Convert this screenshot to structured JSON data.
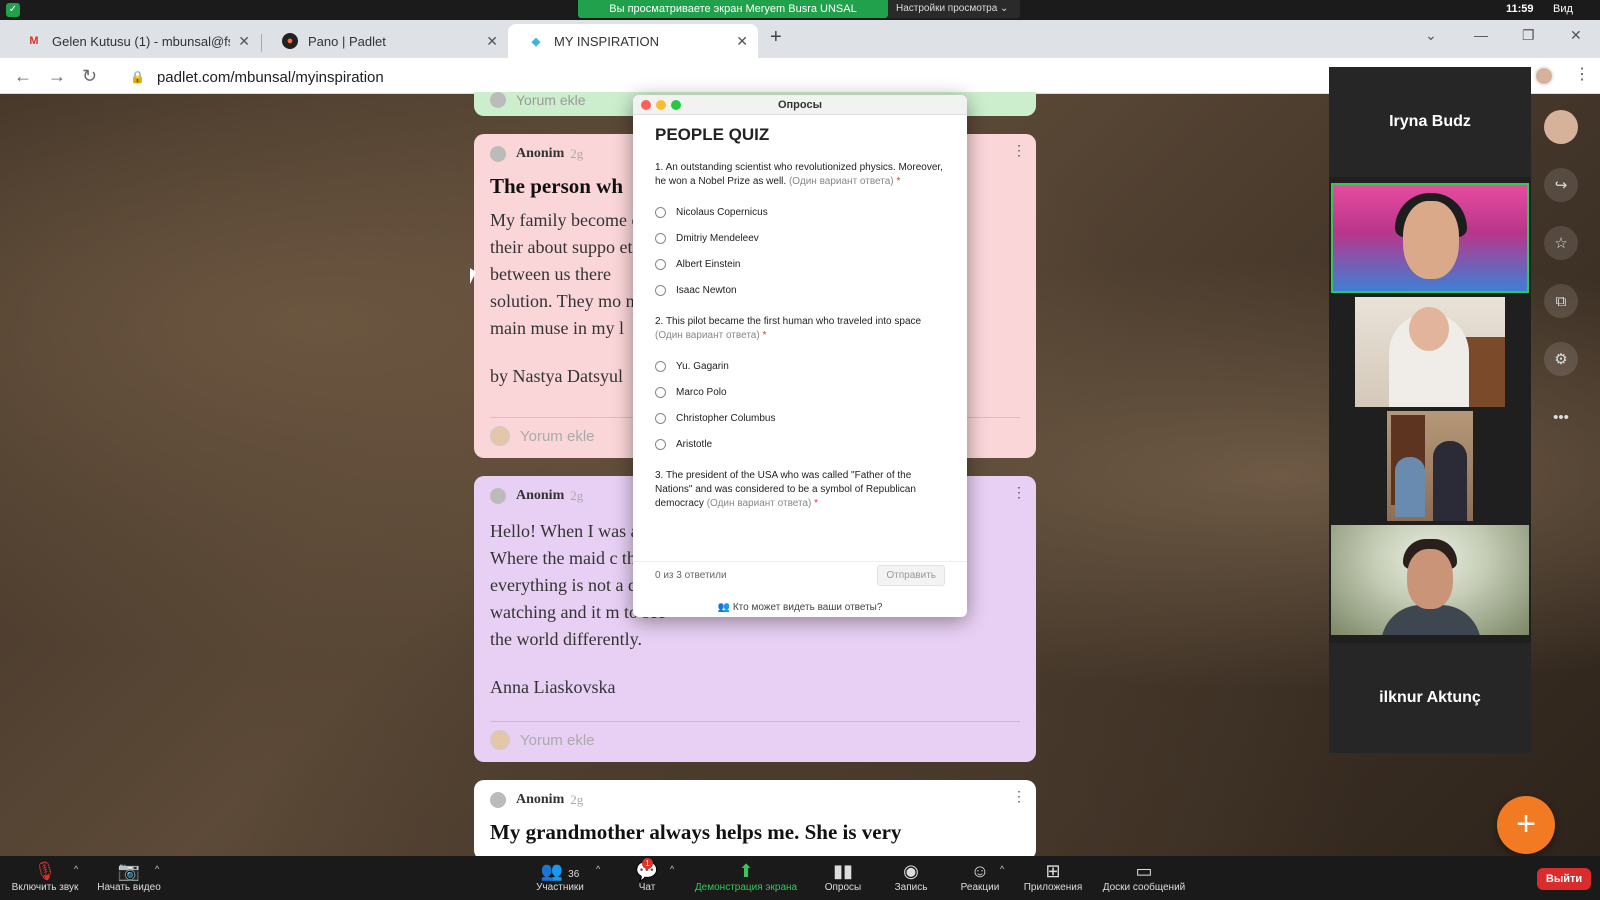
{
  "zoom_top": {
    "share_banner": "Вы просматриваете экран Meryem Busra UNSAL",
    "view_settings": "Настройки просмотра ⌄",
    "clock": "11:59",
    "view_label": "Вид"
  },
  "browser": {
    "tabs": [
      {
        "title": "Gelen Kutusu (1) - mbunsal@fsm",
        "icon": "gmail-icon"
      },
      {
        "title": "Pano | Padlet",
        "icon": "padlet-icon"
      },
      {
        "title": "MY INSPIRATION",
        "icon": "padlet-diamond-icon"
      }
    ],
    "url": "padlet.com/mbunsal/myinspiration"
  },
  "posts": {
    "top_comment": "Yorum ekle",
    "pink": {
      "author": "Anonim",
      "time": "2g",
      "title": "The person wh",
      "lines": [
        "My family become                                                    can ask",
        "their about suppo                                                   etimes",
        "between us there",
        "solution. They mo                                                   ny",
        "main muse in my l"
      ],
      "signature": "by Nastya Datsyul",
      "comment": "Yorum ekle"
    },
    "purple": {
      "author": "Anonim",
      "time": "2g",
      "lines": [
        "Hello! When I was                                                 atrix.",
        "Where the maid c                                                  that",
        "everything is not a                                               d while",
        "watching and it m                                                 to see",
        "the world differently."
      ],
      "signature": "Anna Liaskovska",
      "comment": "Yorum ekle"
    },
    "white": {
      "author": "Anonim",
      "time": "2g",
      "title": "My grandmother always helps me. She is very"
    }
  },
  "quiz": {
    "window_title": "Опросы",
    "title": "PEOPLE QUIZ",
    "questions": [
      {
        "text": "1. An outstanding scientist who revolutionized physics. Moreover, he won a Nobel Prize as well.",
        "hint": "(Один вариант ответа)",
        "required": "*",
        "options": [
          "Nicolaus Copernicus",
          "Dmitriy Mendeleev",
          "Albert Einstein",
          "Isaac Newton"
        ]
      },
      {
        "text": "2. This pilot became the first human who traveled into space",
        "hint": "(Один вариант ответа)",
        "required": "*",
        "options": [
          "Yu. Gagarin",
          "Marco Polo",
          "Christopher Columbus",
          "Aristotle"
        ]
      },
      {
        "text": "3. The president of the USA who was called \"Father of the Nations\" and was considered to be a symbol of Republican democracy",
        "hint": "(Один вариант ответа)",
        "required": "*",
        "options": []
      }
    ],
    "answered": "0 из 3 ответили",
    "submit": "Отправить",
    "who_sees": "Кто может видеть ваши ответы?"
  },
  "participants": {
    "top_name": "Iryna Budz",
    "bottom_name": "ilknur Aktunç"
  },
  "zoom_bar": {
    "mute": "Включить звук",
    "video": "Начать видео",
    "participants_label": "Участники",
    "participants_count": "36",
    "chat": "Чат",
    "chat_badge": "1",
    "share": "Демонстрация экрана",
    "polls": "Опросы",
    "record": "Запись",
    "reactions": "Реакции",
    "apps": "Приложения",
    "whiteboards": "Доски сообщений",
    "leave": "Выйти"
  },
  "colors": {
    "share_green": "#21a14b",
    "padlet_fab": "#f27a22",
    "leave_red": "#d92c2c"
  }
}
